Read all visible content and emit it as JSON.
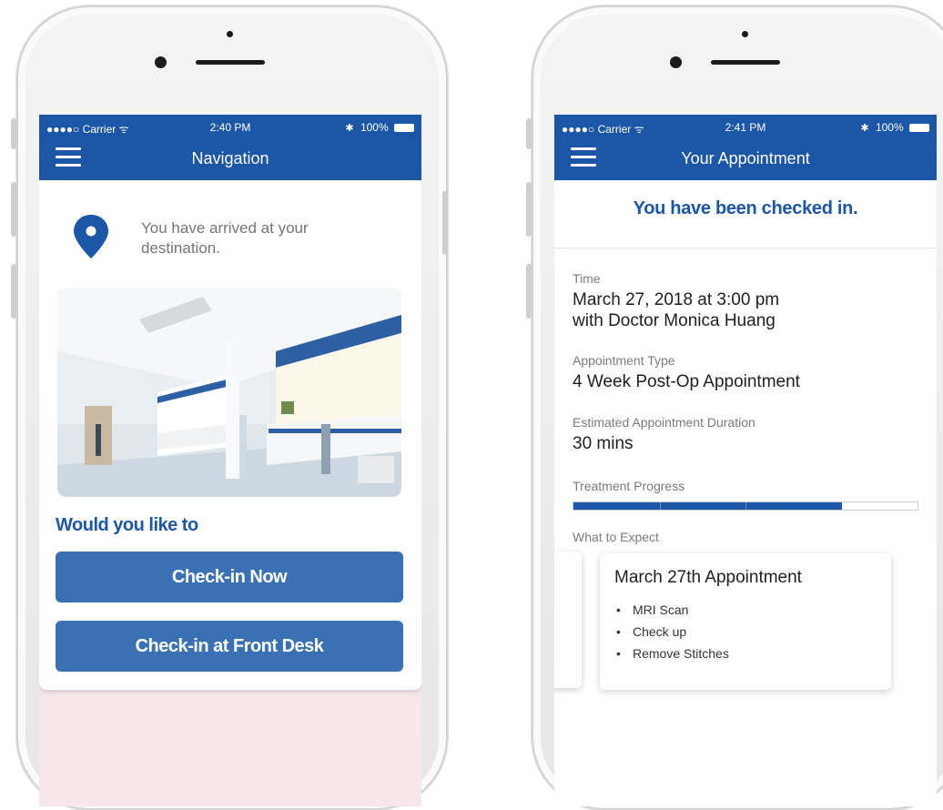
{
  "left_phone": {
    "status": {
      "carrier": "●●●●○ Carrier ᯤ",
      "time": "2:40 PM",
      "battery": "100%"
    },
    "title": "Navigation",
    "arrival_message": "You have arrived at your destination.",
    "prompt": "Would you like to",
    "buttons": {
      "checkin_now": "Check-in Now",
      "checkin_desk": "Check-in at Front Desk"
    },
    "icons": {
      "menu": "hamburger-menu-icon",
      "location": "map-pin-icon",
      "bluetooth": "bluetooth-icon",
      "battery": "battery-icon"
    },
    "accent_color": "#1c56a6"
  },
  "right_phone": {
    "status": {
      "carrier": "●●●●○ Carrier ᯤ",
      "time": "2:41 PM",
      "battery": "100%"
    },
    "title": "Your Appointment",
    "checked_in": "You have been checked in.",
    "time_label": "Time",
    "time_value": "March 27, 2018 at 3:00 pm",
    "doctor": "with Doctor Monica Huang",
    "type_label": "Appointment Type",
    "type_value": "4 Week Post-Op Appointment",
    "duration_label": "Estimated Appointment Duration",
    "duration_value": "30 mins",
    "progress_label": "Treatment Progress",
    "progress_fraction": 0.78,
    "expect_label": "What to Expect",
    "appointment_card": {
      "title": "March 27th Appointment",
      "items": [
        "MRI Scan",
        "Check up",
        "Remove Stitches"
      ]
    }
  }
}
